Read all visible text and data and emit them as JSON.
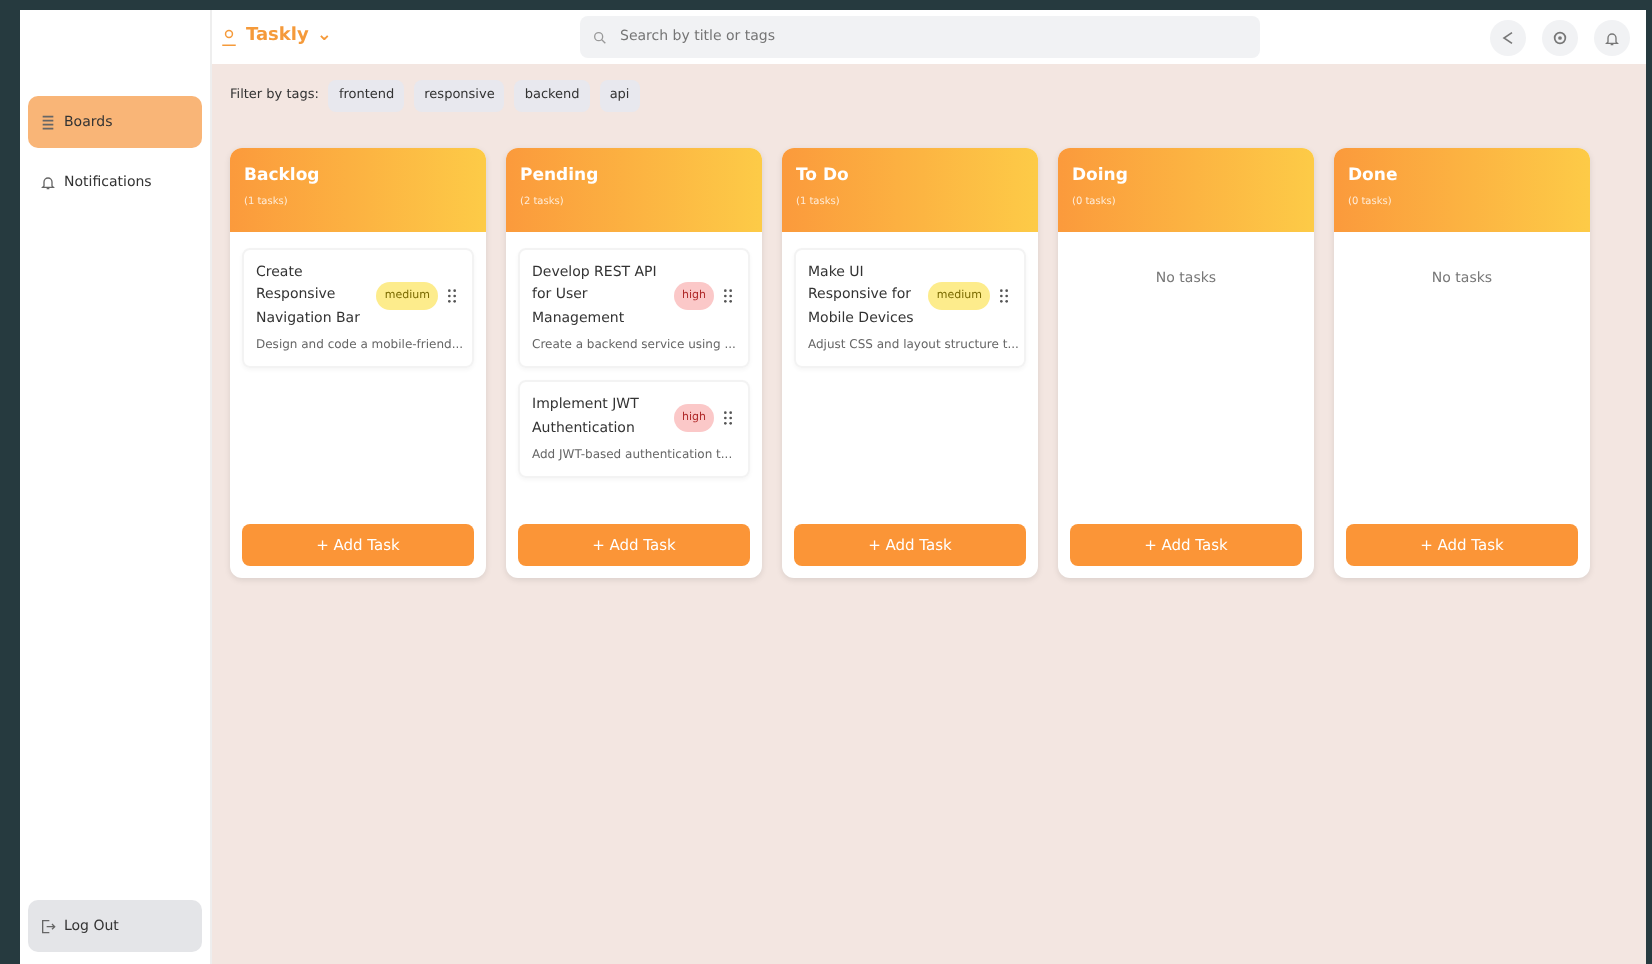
{
  "brand": {
    "name": "Taskly",
    "caret": "⌄"
  },
  "search": {
    "placeholder": "Search by title or tags"
  },
  "sidebar": {
    "items": [
      {
        "label": "Boards",
        "kind": "boards",
        "selected": true
      },
      {
        "label": "Notifications",
        "kind": "bell",
        "selected": false
      }
    ],
    "logout": "Log Out"
  },
  "filter": {
    "label": "Filter by tags:",
    "tags": [
      "frontend",
      "responsive",
      "backend",
      "api"
    ]
  },
  "columns": [
    {
      "title": "Backlog",
      "count": "(1 tasks)",
      "add": "+ Add Task",
      "tasks": [
        {
          "title": "Create Responsive Navigation Bar",
          "priority": "medium",
          "description": "Design and code a mobile-friend..."
        }
      ]
    },
    {
      "title": "Pending",
      "count": "(2 tasks)",
      "add": "+ Add Task",
      "tasks": [
        {
          "title": "Develop REST API for User Management",
          "priority": "high",
          "description": "Create a backend service using ..."
        },
        {
          "title": "Implement JWT Authentication",
          "priority": "high",
          "description": "Add JWT-based authentication t..."
        }
      ]
    },
    {
      "title": "To Do",
      "count": "(1 tasks)",
      "add": "+ Add Task",
      "tasks": [
        {
          "title": "Make UI Responsive for Mobile Devices",
          "priority": "medium",
          "description": "Adjust CSS and layout structure t..."
        }
      ]
    },
    {
      "title": "Doing",
      "count": "(0 tasks)",
      "empty_text": "No tasks",
      "add": "+ Add Task"
    },
    {
      "title": "Done",
      "count": "(0 tasks)",
      "empty_text": "No tasks",
      "add": "+ Add Task"
    }
  ]
}
